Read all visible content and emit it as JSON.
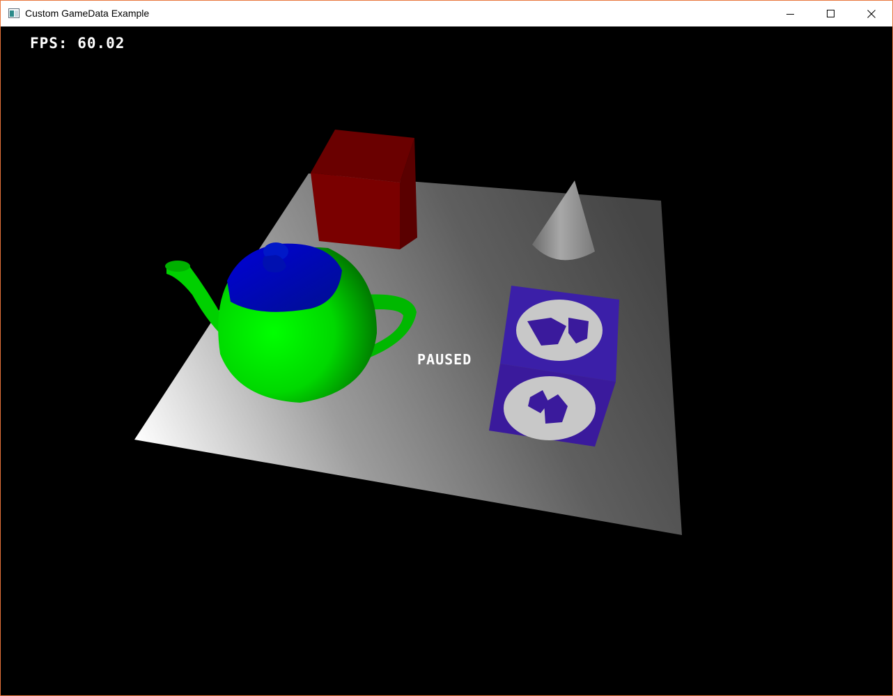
{
  "window": {
    "title": "Custom GameData Example",
    "border_color": "#e8743b"
  },
  "controls": {
    "minimize_icon": "minimize-icon",
    "maximize_icon": "maximize-icon",
    "close_icon": "close-icon"
  },
  "hud": {
    "fps": "FPS: 60.02",
    "status": "PAUSED"
  },
  "scene": {
    "background": "#000000",
    "objects": [
      {
        "name": "red-cube",
        "color": "#8b0000"
      },
      {
        "name": "grey-cone",
        "color": "#9a9a9a"
      },
      {
        "name": "teapot",
        "body_color": "#00e000",
        "lid_color": "#0010c0"
      },
      {
        "name": "logo-cube",
        "color": "#3a1aa0"
      },
      {
        "name": "floor-plane",
        "color": "#bdbdbd"
      }
    ]
  }
}
